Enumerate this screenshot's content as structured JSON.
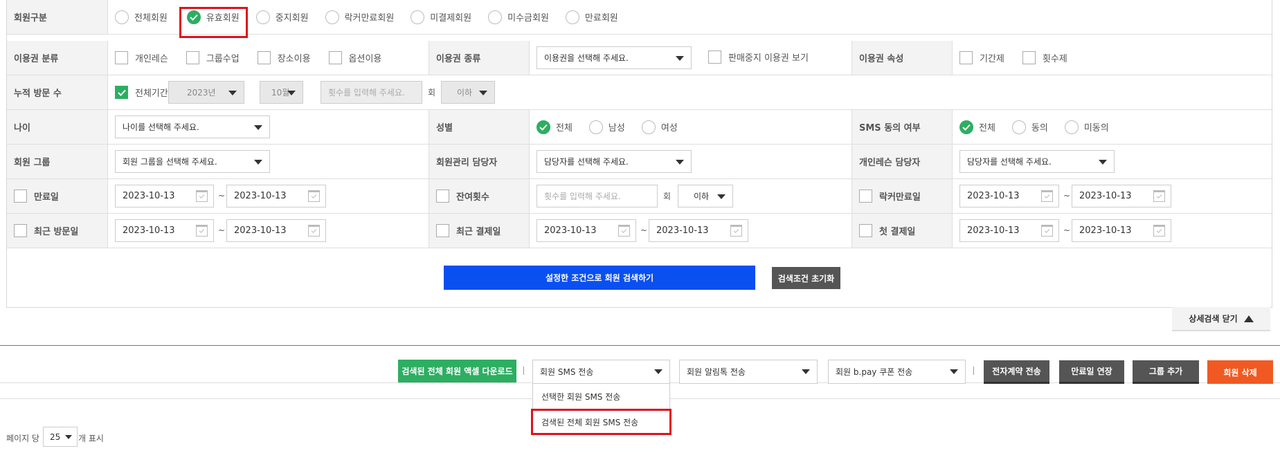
{
  "row1": {
    "label": "회원구분",
    "options": [
      {
        "label": "전체회원",
        "checked": false
      },
      {
        "label": "유효회원",
        "checked": true
      },
      {
        "label": "중지회원",
        "checked": false
      },
      {
        "label": "락커만료회원",
        "checked": false
      },
      {
        "label": "미결제회원",
        "checked": false
      },
      {
        "label": "미수금회원",
        "checked": false
      },
      {
        "label": "만료회원",
        "checked": false
      }
    ]
  },
  "row2": {
    "label": "이용권 분류",
    "options": [
      "개인레슨",
      "그룹수업",
      "장소이용",
      "옵션이용"
    ],
    "type_label": "이용권 종류",
    "type_select": "이용권을 선택해 주세요.",
    "suspended_label": "판매중지 이용권 보기",
    "attr_label": "이용권 속성",
    "attr_options": [
      "기간제",
      "횟수제"
    ]
  },
  "row3": {
    "label": "누적 방문 수",
    "all_period": "전체기간",
    "year": "2023년",
    "month": "10월",
    "count_placeholder": "횟수를 입력해 주세요.",
    "unit": "회",
    "compare": "이하"
  },
  "row4": {
    "age_label": "나이",
    "age_select": "나이를 선택해 주세요.",
    "gender_label": "성별",
    "gender_options": [
      {
        "label": "전체",
        "checked": true
      },
      {
        "label": "남성",
        "checked": false
      },
      {
        "label": "여성",
        "checked": false
      }
    ],
    "sms_label": "SMS 동의 여부",
    "sms_options": [
      {
        "label": "전체",
        "checked": true
      },
      {
        "label": "동의",
        "checked": false
      },
      {
        "label": "미동의",
        "checked": false
      }
    ]
  },
  "row5": {
    "group_label": "회원 그룹",
    "group_select": "회원 그룹을 선택해 주세요.",
    "manager_label": "회원관리 담당자",
    "manager_select": "담당자를 선택해 주세요.",
    "lesson_label": "개인레슨 담당자",
    "lesson_select": "담당자를 선택해 주세요."
  },
  "row6": {
    "expire_label": "만료일",
    "expire_from": "2023-10-13",
    "expire_to": "2023-10-13",
    "remain_label": "잔여횟수",
    "remain_placeholder": "횟수를 입력해 주세요.",
    "remain_unit": "회",
    "remain_compare": "이하",
    "locker_label": "락커만료일",
    "locker_from": "2023-10-13",
    "locker_to": "2023-10-13"
  },
  "row7": {
    "visit_label": "최근 방문일",
    "visit_from": "2023-10-13",
    "visit_to": "2023-10-13",
    "pay_label": "최근 결제일",
    "pay_from": "2023-10-13",
    "pay_to": "2023-10-13",
    "first_label": "첫 결제일",
    "first_from": "2023-10-13",
    "first_to": "2023-10-13"
  },
  "tilde": "~",
  "search_button": "설정한 조건으로 회원 검색하기",
  "reset_button": "검색조건 초기화",
  "close_detail_button": "상세검색 닫기",
  "toolbar": {
    "excel": "검색된 전체 회원 액셀 다운로드",
    "sms_select": "회원 SMS 전송",
    "sms_menu": [
      "선택한 회원 SMS 전송",
      "검색된 전체 회원 SMS 전송"
    ],
    "alimtalk_select": "회원 알림톡 전송",
    "coupon_select": "회원 b.pay 쿠폰 전송",
    "contract": "전자계약 전송",
    "extend": "만료일 연장",
    "add_group": "그룹 추가",
    "delete": "회원 삭제"
  },
  "paging": {
    "prefix": "페이지 당",
    "value": "25",
    "suffix": "개 표시"
  },
  "colors": {
    "accent_green": "#2dae62",
    "primary_blue": "#0a4ff0",
    "delete_orange": "#f05a22",
    "highlight_red": "#e0101a"
  }
}
